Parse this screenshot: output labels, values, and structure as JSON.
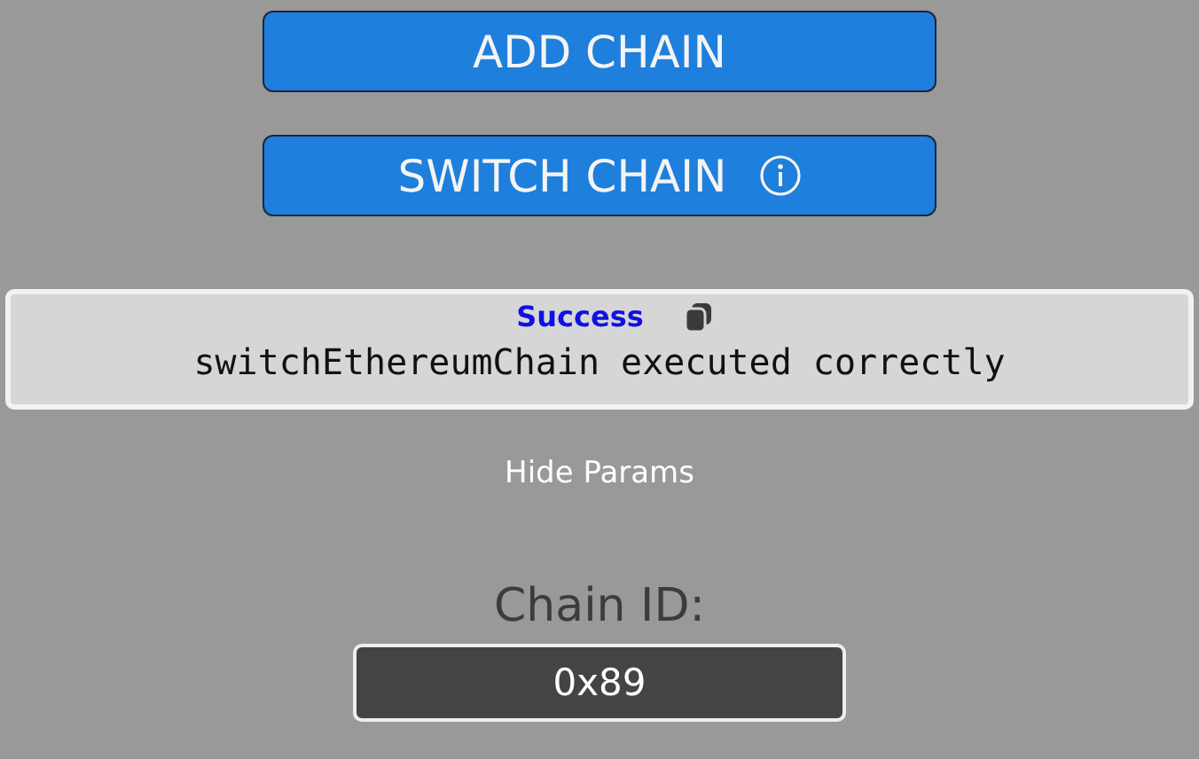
{
  "buttons": [
    {
      "label": "ADD CHAIN",
      "info": false
    },
    {
      "label": "SWITCH CHAIN",
      "info": true
    }
  ],
  "result": {
    "status": "Success",
    "message": "switchEthereumChain executed correctly"
  },
  "params_toggle": "Hide Params",
  "chain_id": {
    "label": "Chain ID:",
    "value": "0x89"
  }
}
